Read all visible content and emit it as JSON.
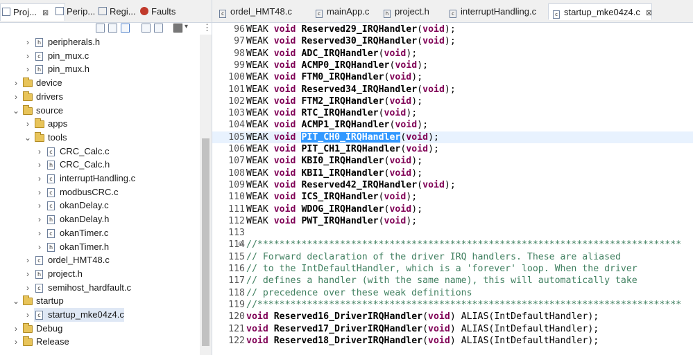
{
  "left_tabs": [
    {
      "label": "Proj...",
      "icon": "project-explorer-icon",
      "active": true,
      "close": "⊠"
    },
    {
      "label": "Perip...",
      "icon": "peripherals-icon"
    },
    {
      "label": "Regi...",
      "icon": "registers-icon"
    },
    {
      "label": "Faults",
      "icon": "faults-icon"
    }
  ],
  "tree": [
    {
      "label": "peripherals.h",
      "type": "h",
      "chev": "›",
      "indent": 2
    },
    {
      "label": "pin_mux.c",
      "type": "c",
      "chev": "›",
      "indent": 2
    },
    {
      "label": "pin_mux.h",
      "type": "h",
      "chev": "›",
      "indent": 2
    },
    {
      "label": "device",
      "type": "folder",
      "chev": "›",
      "indent": 1
    },
    {
      "label": "drivers",
      "type": "folder",
      "chev": "›",
      "indent": 1
    },
    {
      "label": "source",
      "type": "folder",
      "chev": "⌄",
      "indent": 1
    },
    {
      "label": "apps",
      "type": "folder",
      "chev": "›",
      "indent": 2
    },
    {
      "label": "tools",
      "type": "folder",
      "chev": "⌄",
      "indent": 2
    },
    {
      "label": "CRC_Calc.c",
      "type": "c",
      "chev": "›",
      "indent": 3
    },
    {
      "label": "CRC_Calc.h",
      "type": "h",
      "chev": "›",
      "indent": 3
    },
    {
      "label": "interruptHandling.c",
      "type": "c",
      "chev": "›",
      "indent": 3
    },
    {
      "label": "modbusCRC.c",
      "type": "c",
      "chev": "›",
      "indent": 3
    },
    {
      "label": "okanDelay.c",
      "type": "c",
      "chev": "›",
      "indent": 3
    },
    {
      "label": "okanDelay.h",
      "type": "h",
      "chev": "›",
      "indent": 3
    },
    {
      "label": "okanTimer.c",
      "type": "c",
      "chev": "›",
      "indent": 3
    },
    {
      "label": "okanTimer.h",
      "type": "h",
      "chev": "›",
      "indent": 3
    },
    {
      "label": "ordel_HMT48.c",
      "type": "c",
      "chev": "›",
      "indent": 2
    },
    {
      "label": "project.h",
      "type": "h",
      "chev": "›",
      "indent": 2
    },
    {
      "label": "semihost_hardfault.c",
      "type": "c",
      "chev": "›",
      "indent": 2
    },
    {
      "label": "startup",
      "type": "folder",
      "chev": "⌄",
      "indent": 1
    },
    {
      "label": "startup_mke04z4.c",
      "type": "c",
      "chev": "›",
      "indent": 2,
      "selected": true
    },
    {
      "label": "Debug",
      "type": "folder",
      "chev": "›",
      "indent": 1
    },
    {
      "label": "Release",
      "type": "folder",
      "chev": "›",
      "indent": 1
    }
  ],
  "editor_tabs": [
    {
      "label": "ordel_HMT48.c",
      "icon": "c-file-icon"
    },
    {
      "label": "mainApp.c",
      "icon": "c-file-icon"
    },
    {
      "label": "project.h",
      "icon": "h-file-icon"
    },
    {
      "label": "interruptHandling.c",
      "icon": "c-file-icon"
    },
    {
      "label": "startup_mke04z4.c",
      "icon": "c-file-icon",
      "active": true,
      "close": "⊠"
    }
  ],
  "code_lines": [
    {
      "n": "96",
      "kind": "weak",
      "name": "Reserved29_IRQHandler"
    },
    {
      "n": "97",
      "kind": "weak",
      "name": "Reserved30_IRQHandler"
    },
    {
      "n": "98",
      "kind": "weak",
      "name": "ADC_IRQHandler"
    },
    {
      "n": "99",
      "kind": "weak",
      "name": "ACMP0_IRQHandler"
    },
    {
      "n": "100",
      "kind": "weak",
      "name": "FTM0_IRQHandler"
    },
    {
      "n": "101",
      "kind": "weak",
      "name": "Reserved34_IRQHandler"
    },
    {
      "n": "102",
      "kind": "weak",
      "name": "FTM2_IRQHandler"
    },
    {
      "n": "103",
      "kind": "weak",
      "name": "RTC_IRQHandler"
    },
    {
      "n": "104",
      "kind": "weak",
      "name": "ACMP1_IRQHandler"
    },
    {
      "n": "105",
      "kind": "weak",
      "name": "PIT_CH0_IRQHandler",
      "highlight": true
    },
    {
      "n": "106",
      "kind": "weak",
      "name": "PIT_CH1_IRQHandler"
    },
    {
      "n": "107",
      "kind": "weak",
      "name": "KBI0_IRQHandler"
    },
    {
      "n": "108",
      "kind": "weak",
      "name": "KBI1_IRQHandler"
    },
    {
      "n": "109",
      "kind": "weak",
      "name": "Reserved42_IRQHandler"
    },
    {
      "n": "110",
      "kind": "weak",
      "name": "ICS_IRQHandler"
    },
    {
      "n": "111",
      "kind": "weak",
      "name": "WDOG_IRQHandler"
    },
    {
      "n": "112",
      "kind": "weak",
      "name": "PWT_IRQHandler"
    },
    {
      "n": "113",
      "kind": "blank"
    },
    {
      "n": "114",
      "kind": "comment",
      "text": "//*****************************************************************************",
      "fold": "⊖"
    },
    {
      "n": "115",
      "kind": "comment",
      "text": "// Forward declaration of the driver IRQ handlers. These are aliased"
    },
    {
      "n": "116",
      "kind": "comment",
      "text": "// to the IntDefaultHandler, which is a 'forever' loop. When the driver"
    },
    {
      "n": "117",
      "kind": "comment",
      "text": "// defines a handler (with the same name), this will automatically take"
    },
    {
      "n": "118",
      "kind": "comment",
      "text": "// precedence over these weak definitions"
    },
    {
      "n": "119",
      "kind": "comment",
      "text": "//*****************************************************************************"
    },
    {
      "n": "120",
      "kind": "alias",
      "name": "Reserved16_DriverIRQHandler"
    },
    {
      "n": "121",
      "kind": "alias",
      "name": "Reserved17_DriverIRQHandler"
    },
    {
      "n": "122",
      "kind": "alias",
      "name": "Reserved18_DriverIRQHandler"
    }
  ],
  "syntax": {
    "weak": "WEAK",
    "void": "void",
    "open": "(",
    "close": ");",
    "alias_pre": ") ALIAS(",
    "alias_target": "IntDefaultHandler",
    "alias_post": ");"
  },
  "colors": {
    "keyword": "#7f0055",
    "comment": "#3f7f5f",
    "selection": "#3399ff",
    "current_line": "#e8f2fe"
  }
}
